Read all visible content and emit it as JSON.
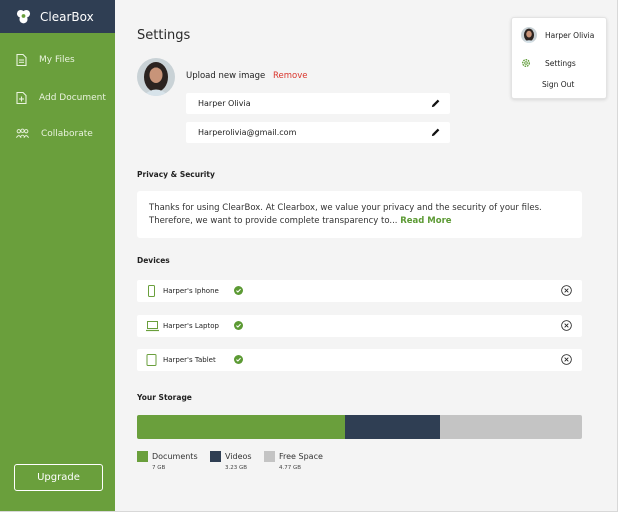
{
  "brand": {
    "name": "ClearBox"
  },
  "sidebar": {
    "items": [
      {
        "label": "My Files",
        "icon": "file-icon"
      },
      {
        "label": "Add Document",
        "icon": "add-document-icon"
      },
      {
        "label": "Collaborate",
        "icon": "people-icon"
      }
    ],
    "upgrade_label": "Upgrade"
  },
  "page": {
    "title": "Settings"
  },
  "profile_edit": {
    "upload_label": "Upload new image",
    "remove_label": "Remove",
    "name_value": "Harper Olivia",
    "email_value": "Harperolivia@gmail.com"
  },
  "privacy": {
    "title": "Privacy & Security",
    "body_line1": "Thanks for using ClearBox. At Clearbox, we value your privacy and the security of your files.",
    "body_line2": "Therefore, we want to provide complete transparency to...",
    "read_more": "Read More"
  },
  "devices": {
    "title": "Devices",
    "items": [
      {
        "name": "Harper's Iphone",
        "icon": "phone-icon",
        "verified": true
      },
      {
        "name": "Harper's Laptop",
        "icon": "laptop-icon",
        "verified": true
      },
      {
        "name": "Harper's Tablet",
        "icon": "tablet-icon",
        "verified": true
      }
    ]
  },
  "storage": {
    "title": "Your Storage",
    "segments": [
      {
        "label": "Documents",
        "size": "7 GB",
        "gb": 7,
        "color": "#6a9f3c"
      },
      {
        "label": "Videos",
        "size": "3.23 GB",
        "gb": 3.23,
        "color": "#2f3e53"
      },
      {
        "label": "Free Space",
        "size": "4.77 GB",
        "gb": 4.77,
        "color": "#c4c4c4"
      }
    ]
  },
  "profile_menu": {
    "name": "Harper Olivia",
    "settings_label": "Settings",
    "signout_label": "Sign Out"
  },
  "colors": {
    "sidebar": "#6a9f3c",
    "brand_bar": "#2f3e53",
    "accent": "#5c9a34",
    "danger": "#d9342b",
    "background": "#f4f4f4"
  }
}
